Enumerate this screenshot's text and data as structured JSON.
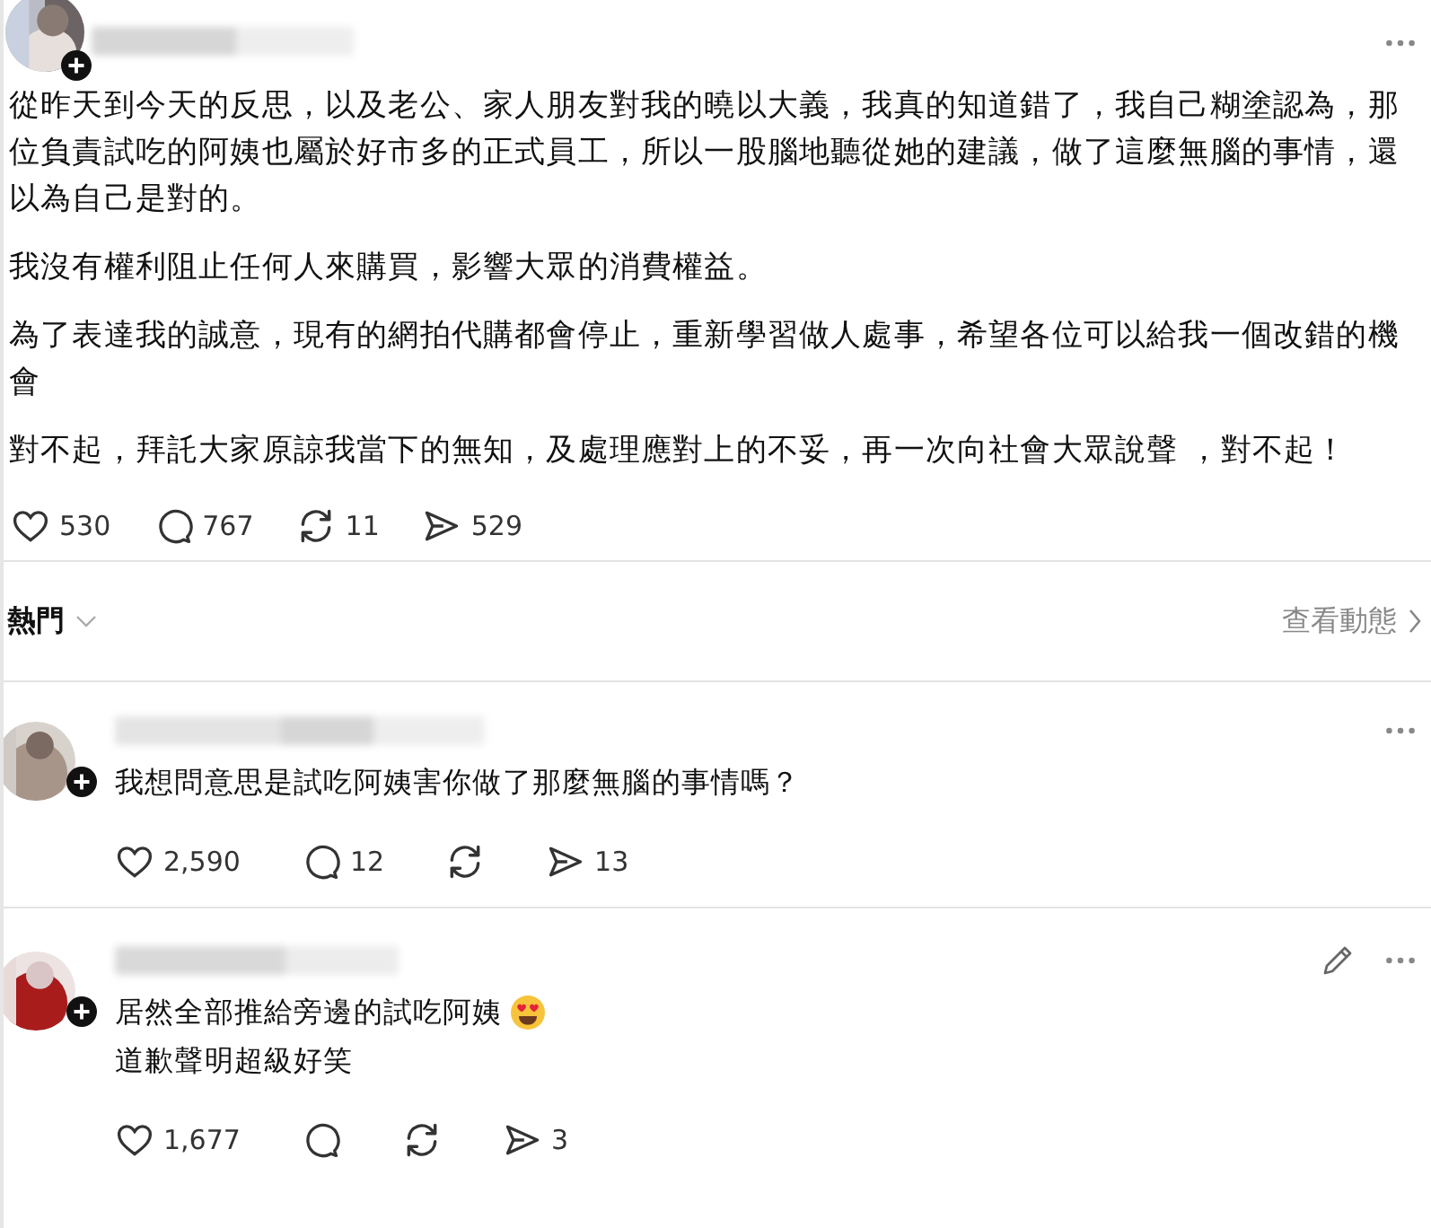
{
  "post": {
    "paragraphs": [
      "從昨天到今天的反思，以及老公、家人朋友對我的曉以大義，我真的知道錯了，我自己糊塗認為，那位負責試吃的阿姨也屬於好市多的正式員工，所以一股腦地聽從她的建議，做了這麼無腦的事情，還以為自己是對的。",
      "我沒有權利阻止任何人來購買，影響大眾的消費權益。",
      "為了表達我的誠意，現有的網拍代購都會停止，重新學習做人處事，希望各位可以給我一個改錯的機會",
      "對不起，拜託大家原諒我當下的無知，及處理應對上的不妥，再一次向社會大眾說聲 ，對不起！"
    ],
    "actions": [
      {
        "kind": "like",
        "count": "530"
      },
      {
        "kind": "comment",
        "count": "767"
      },
      {
        "kind": "repost",
        "count": "11"
      },
      {
        "kind": "share",
        "count": "529"
      }
    ]
  },
  "sort": {
    "label": "熱門",
    "link": "查看動態"
  },
  "comments": [
    {
      "editable": false,
      "lines": [
        {
          "kind": "plain",
          "text": "我想問意思是試吃阿姨害你做了那麼無腦的事情嗎？"
        }
      ],
      "actions": [
        {
          "kind": "like",
          "count": "2,590"
        },
        {
          "kind": "comment",
          "count": "12"
        },
        {
          "kind": "repost"
        },
        {
          "kind": "share",
          "count": "13"
        }
      ]
    },
    {
      "editable": true,
      "lines": [
        {
          "kind": "emoji",
          "text": "居然全部推給旁邊的試吃阿姨"
        },
        {
          "kind": "plain",
          "text": "道歉聲明超級好笑"
        }
      ],
      "actions": [
        {
          "kind": "like",
          "count": "1,677"
        },
        {
          "kind": "comment"
        },
        {
          "kind": "repost"
        },
        {
          "kind": "share",
          "count": "3"
        }
      ]
    }
  ]
}
